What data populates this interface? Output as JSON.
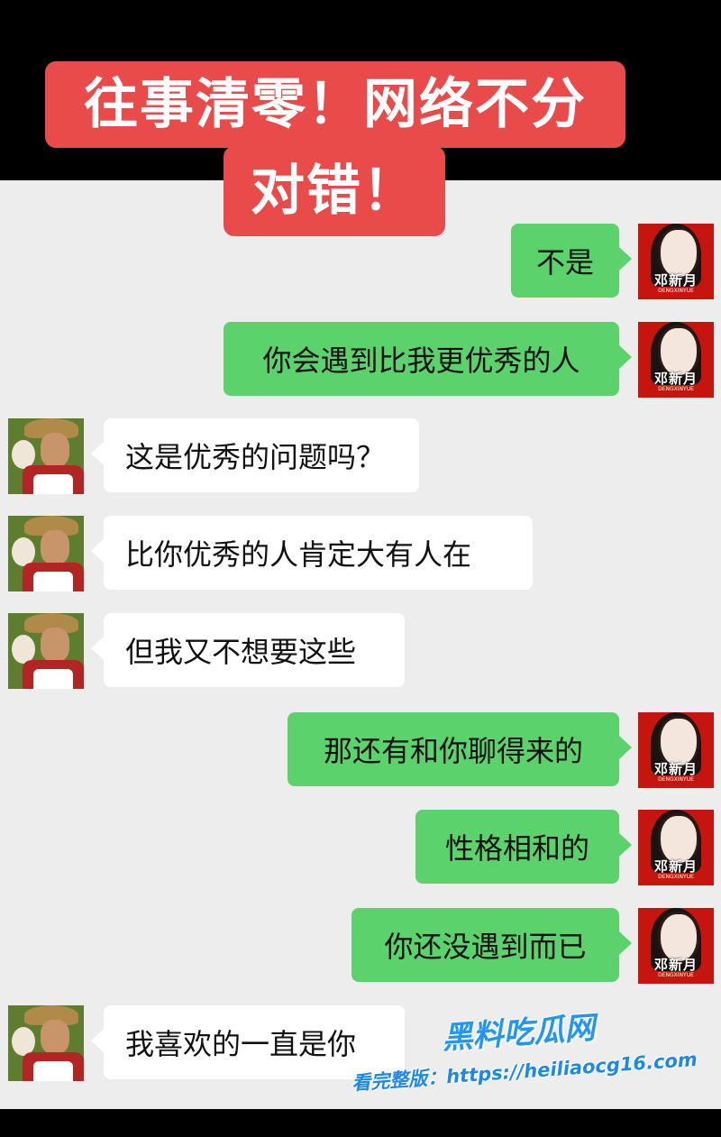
{
  "banner": {
    "line1": "往事清零！网络不分",
    "line2": "对错！"
  },
  "avatars": {
    "girl": {
      "name": "邓新月",
      "sub": "DENGXINYUE"
    }
  },
  "messages": [
    {
      "side": "right",
      "text": "不是"
    },
    {
      "side": "right",
      "text": "你会遇到比我更优秀的人"
    },
    {
      "side": "left",
      "text": "这是优秀的问题吗？"
    },
    {
      "side": "left",
      "text": "比你优秀的人肯定大有人在"
    },
    {
      "side": "left",
      "text": "但我又不想要这些"
    },
    {
      "side": "right",
      "text": "那还有和你聊得来的"
    },
    {
      "side": "right",
      "text": "性格相和的"
    },
    {
      "side": "right",
      "text": "你还没遇到而已"
    },
    {
      "side": "left",
      "text": "我喜欢的一直是你"
    }
  ],
  "watermark": {
    "logo": "黑料吃瓜网",
    "url": "看完整版：https://heiliaocg16.com"
  },
  "colors": {
    "banner": "#e94a4a",
    "sent_bubble": "#5bd26b",
    "received_bubble": "#ffffff",
    "chat_background": "#ededed",
    "watermark": "#2196f3"
  }
}
